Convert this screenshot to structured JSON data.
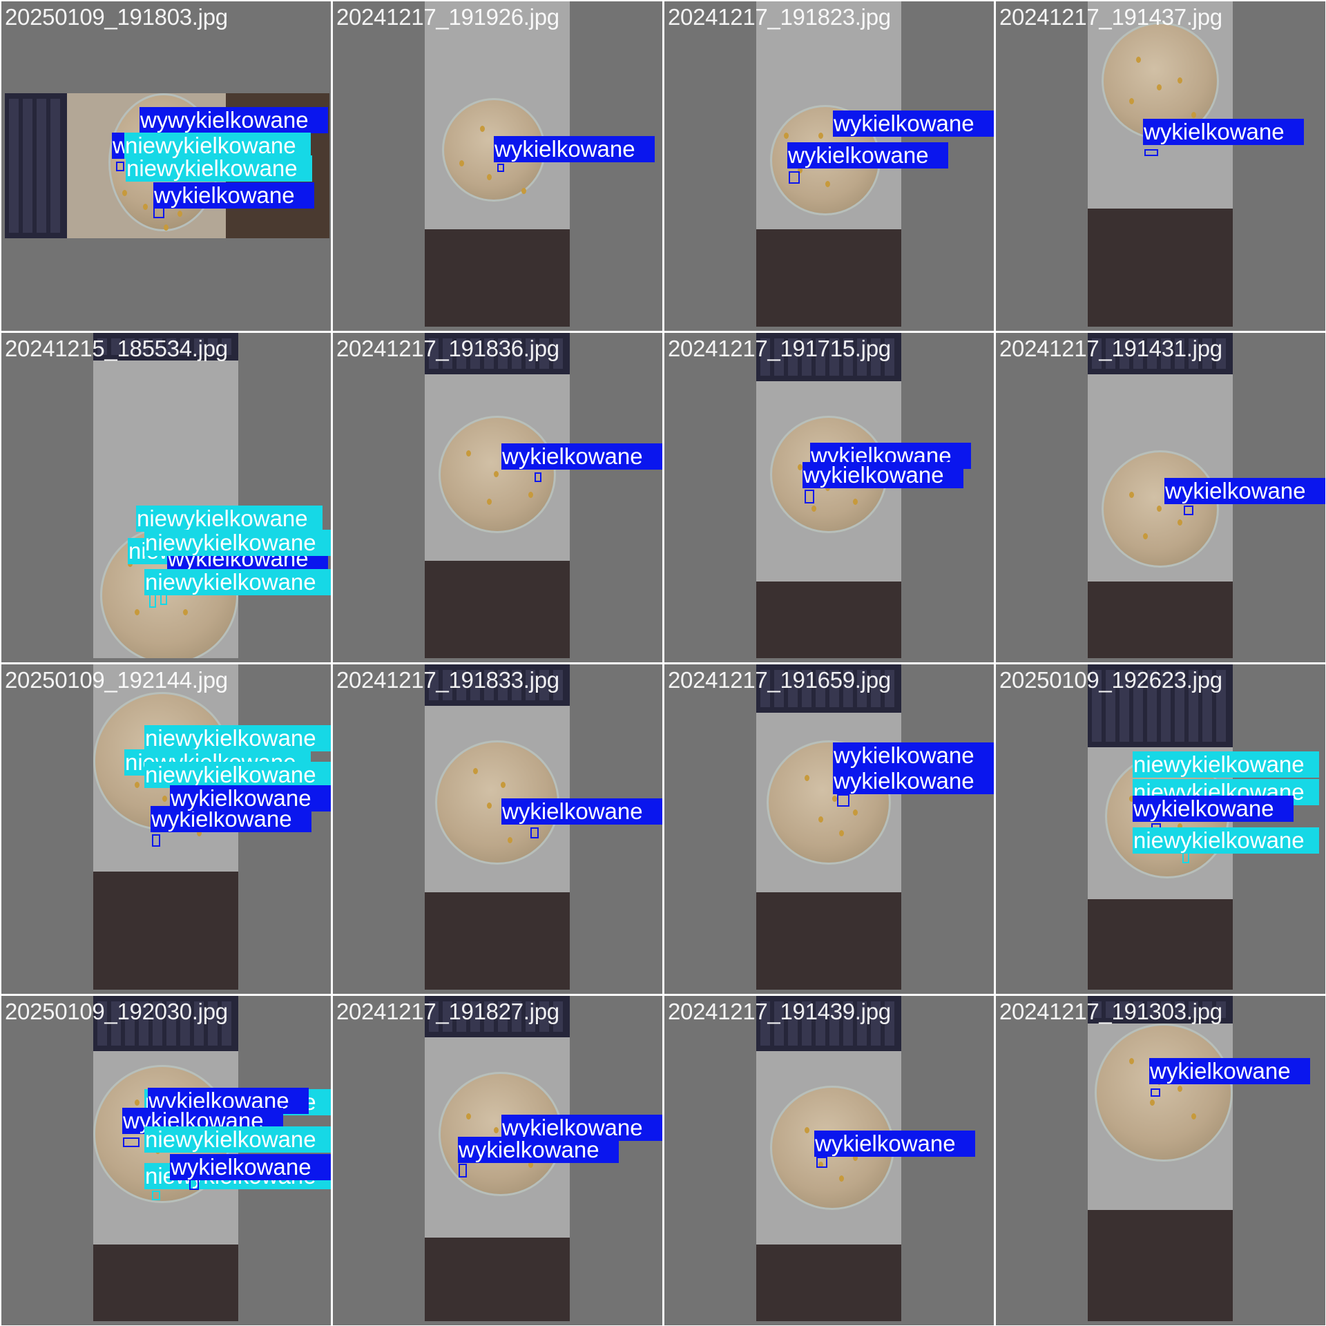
{
  "colors": {
    "background": "#737373",
    "grid_lines": "#ffffff",
    "class_wykielkowane": "#0a16ee",
    "class_niewykielkowane": "#16d8e6",
    "filename_text": "#ffffff"
  },
  "classes": [
    "wykielkowane",
    "niewykielkowane"
  ],
  "tiles": [
    {
      "filename": "20250109_191803.jpg",
      "labels": [
        "wykielkowane",
        "wykielkowane",
        "wykielkowane",
        "wykielkowane",
        "niewykielkowane",
        "niewykielkowane",
        "wykielkowane"
      ]
    },
    {
      "filename": "20241217_191926.jpg",
      "labels": [
        "wykielkowane"
      ]
    },
    {
      "filename": "20241217_191823.jpg",
      "labels": [
        "wykielkowane",
        "wykielkowane"
      ]
    },
    {
      "filename": "20241217_191437.jpg",
      "labels": [
        "wykielkowane"
      ]
    },
    {
      "filename": "20241215_185534.jpg",
      "labels": [
        "niewykielkowane",
        "niewykielkowane",
        "niewykielkowane",
        "wykielkowane",
        "wykielkowane",
        "niewykielkowane",
        "niewykielkowane"
      ]
    },
    {
      "filename": "20241217_191836.jpg",
      "labels": [
        "wykielkowane"
      ]
    },
    {
      "filename": "20241217_191715.jpg",
      "labels": [
        "wykielkowane",
        "wykielkowane"
      ]
    },
    {
      "filename": "20241217_191431.jpg",
      "labels": [
        "wykielkowane"
      ]
    },
    {
      "filename": "20250109_192144.jpg",
      "labels": [
        "niewykielkowane",
        "niewykielkowane",
        "wykielkowane",
        "niewykielkowane",
        "wykielkowane",
        "wykielkowane"
      ]
    },
    {
      "filename": "20241217_191833.jpg",
      "labels": [
        "wykielkowane"
      ]
    },
    {
      "filename": "20241217_191659.jpg",
      "labels": [
        "wykielkowane",
        "wykielkowane"
      ]
    },
    {
      "filename": "20250109_192623.jpg",
      "labels": [
        "niewykielkowane",
        "niewykielkowane",
        "wykielkowane",
        "niewykielkowane",
        "niewykielkowane"
      ]
    },
    {
      "filename": "20250109_192030.jpg",
      "labels": [
        "niewykielkowane",
        "wykielkowane",
        "wykielkowane",
        "niewykielkowane",
        "niewykielkowane",
        "niewykielkowane",
        "wykielkowane"
      ]
    },
    {
      "filename": "20241217_191827.jpg",
      "labels": [
        "wykielkowane",
        "wykielkowane"
      ]
    },
    {
      "filename": "20241217_191439.jpg",
      "labels": [
        "wykielkowane"
      ]
    },
    {
      "filename": "20241217_191303.jpg",
      "labels": [
        "wykielkowane"
      ]
    }
  ]
}
